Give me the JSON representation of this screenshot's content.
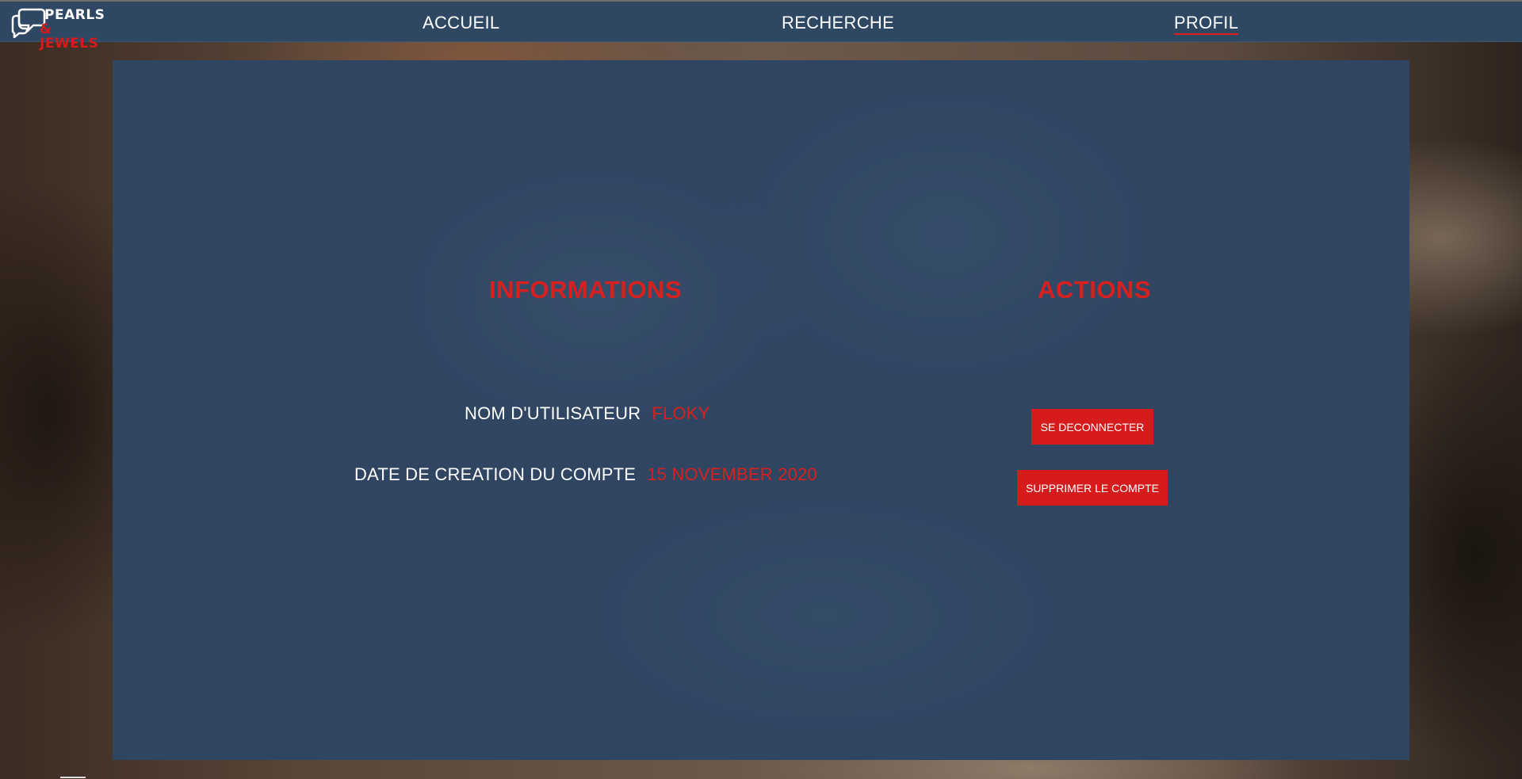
{
  "header": {
    "logo": {
      "line1": "PEARLS",
      "line2": "& JEWELS",
      "icon": "chat-bubbles-icon"
    },
    "nav": [
      {
        "label": "ACCUEIL",
        "active": false
      },
      {
        "label": "RECHERCHE",
        "active": false
      },
      {
        "label": "PROFIL",
        "active": true
      }
    ]
  },
  "profile": {
    "informations": {
      "title": "INFORMATIONS",
      "username_label": "NOM D'UTILISATEUR",
      "username_value": "FLOKY",
      "created_label": "DATE DE CREATION DU COMPTE",
      "created_value": "15 NOVEMBER 2020"
    },
    "actions": {
      "title": "ACTIONS",
      "logout_label": "SE DECONNECTER",
      "delete_label": "SUPPRIMER LE COMPTE"
    }
  },
  "colors": {
    "navbar": "#2e4763",
    "panel": "#2f4562",
    "accent": "#d8201e",
    "text": "#ffffff"
  }
}
